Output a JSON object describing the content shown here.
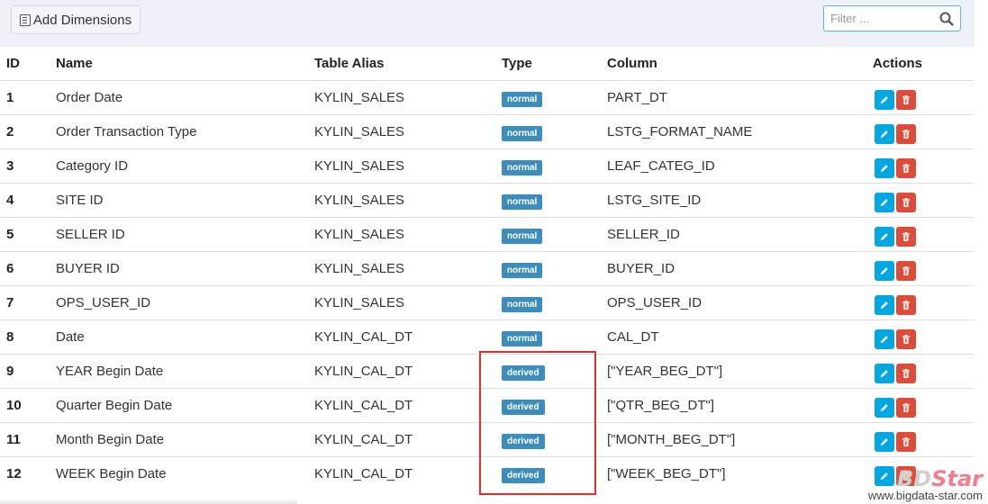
{
  "toolbar": {
    "add_label": "Add Dimensions",
    "filter_placeholder": "Filter ..."
  },
  "table": {
    "headers": {
      "id": "ID",
      "name": "Name",
      "alias": "Table Alias",
      "type": "Type",
      "column": "Column",
      "actions": "Actions"
    },
    "rows": [
      {
        "id": "1",
        "name": "Order Date",
        "alias": "KYLIN_SALES",
        "type": "normal",
        "column": "PART_DT"
      },
      {
        "id": "2",
        "name": "Order Transaction Type",
        "alias": "KYLIN_SALES",
        "type": "normal",
        "column": "LSTG_FORMAT_NAME"
      },
      {
        "id": "3",
        "name": "Category ID",
        "alias": "KYLIN_SALES",
        "type": "normal",
        "column": "LEAF_CATEG_ID"
      },
      {
        "id": "4",
        "name": "SITE ID",
        "alias": "KYLIN_SALES",
        "type": "normal",
        "column": "LSTG_SITE_ID"
      },
      {
        "id": "5",
        "name": "SELLER ID",
        "alias": "KYLIN_SALES",
        "type": "normal",
        "column": "SELLER_ID"
      },
      {
        "id": "6",
        "name": "BUYER ID",
        "alias": "KYLIN_SALES",
        "type": "normal",
        "column": "BUYER_ID"
      },
      {
        "id": "7",
        "name": "OPS_USER_ID",
        "alias": "KYLIN_SALES",
        "type": "normal",
        "column": "OPS_USER_ID"
      },
      {
        "id": "8",
        "name": "Date",
        "alias": "KYLIN_CAL_DT",
        "type": "normal",
        "column": "CAL_DT"
      },
      {
        "id": "9",
        "name": "YEAR Begin Date",
        "alias": "KYLIN_CAL_DT",
        "type": "derived",
        "column": "[\"YEAR_BEG_DT\"]"
      },
      {
        "id": "10",
        "name": "Quarter Begin Date",
        "alias": "KYLIN_CAL_DT",
        "type": "derived",
        "column": "[\"QTR_BEG_DT\"]"
      },
      {
        "id": "11",
        "name": "Month Begin Date",
        "alias": "KYLIN_CAL_DT",
        "type": "derived",
        "column": "[\"MONTH_BEG_DT\"]"
      },
      {
        "id": "12",
        "name": "WEEK Begin Date",
        "alias": "KYLIN_CAL_DT",
        "type": "derived",
        "column": "[\"WEEK_BEG_DT\"]"
      }
    ]
  },
  "icons": {
    "add": "list-icon",
    "search": "search-icon",
    "edit": "pencil-icon",
    "delete": "trash-icon"
  },
  "colors": {
    "badge": "#3c8dbc",
    "edit": "#00a7e0",
    "delete": "#dd4b39",
    "highlight": "#e0302c"
  },
  "watermark": {
    "logo_b": "BD",
    "logo_s": "Star",
    "url": "www.bigdata-star.com"
  }
}
